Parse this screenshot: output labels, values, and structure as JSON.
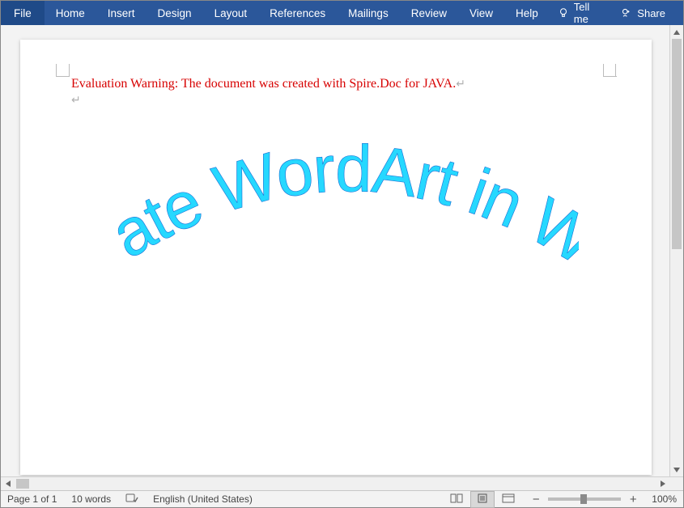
{
  "ribbon": {
    "tabs": {
      "file": "File",
      "home": "Home",
      "insert": "Insert",
      "design": "Design",
      "layout": "Layout",
      "references": "References",
      "mailings": "Mailings",
      "review": "Review",
      "view": "View",
      "help": "Help"
    },
    "tellme": "Tell me",
    "share": "Share"
  },
  "document": {
    "warning_text": "Evaluation Warning: The document was created with Spire.Doc for JAVA.",
    "wordart_text": "Create WordArt in Word",
    "para_symbol": "↵"
  },
  "statusbar": {
    "page": "Page 1 of 1",
    "words": "10 words",
    "language": "English (United States)",
    "zoom": "100%"
  },
  "colors": {
    "ribbon_bg": "#2b579a",
    "warning": "#d70000",
    "wordart_fill": "#26d8ff",
    "wordart_stroke": "#1a6fd4"
  }
}
